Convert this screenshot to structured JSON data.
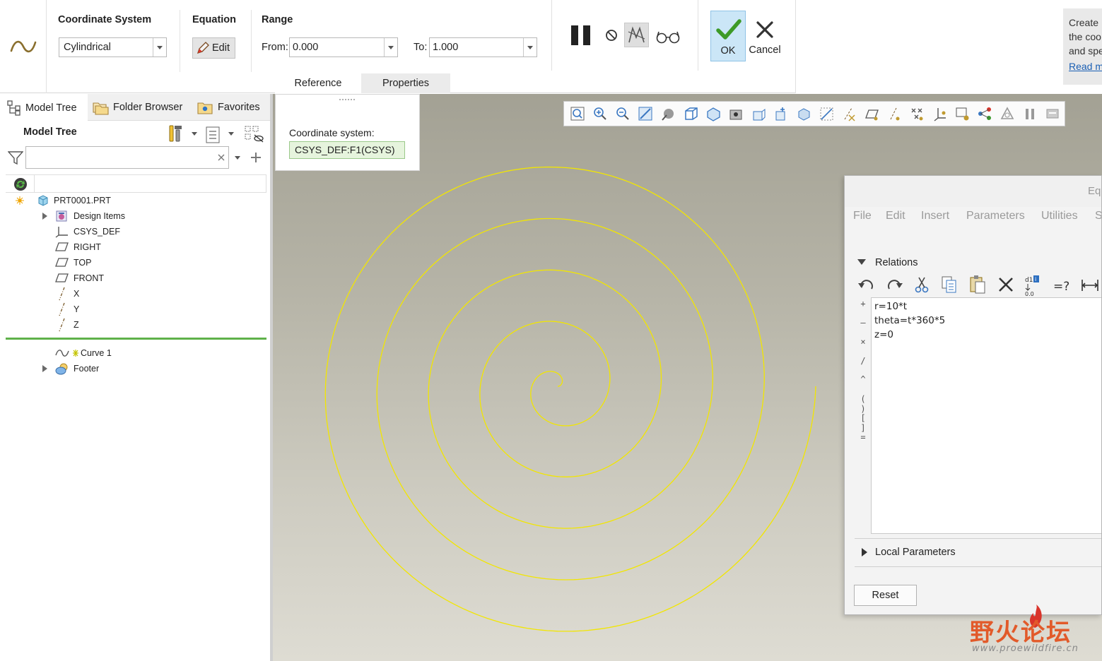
{
  "ribbon": {
    "coord_system": {
      "label": "Coordinate System",
      "value": "Cylindrical"
    },
    "equation": {
      "label": "Equation",
      "edit_label": "Edit"
    },
    "range": {
      "label": "Range",
      "from_label": "From:",
      "from_value": "0.000",
      "to_label": "To:",
      "to_value": "1.000"
    },
    "ok_label": "OK",
    "cancel_label": "Cancel",
    "tabs": [
      {
        "label": "Reference"
      },
      {
        "label": "Properties"
      }
    ],
    "tip_lines": [
      "Create",
      "the coo",
      "and spe"
    ],
    "tip_link": "Read m"
  },
  "left_panel": {
    "tabs": [
      {
        "label": "Model Tree"
      },
      {
        "label": "Folder Browser"
      },
      {
        "label": "Favorites"
      }
    ],
    "tree_title": "Model Tree",
    "search_placeholder": "",
    "tree": [
      {
        "label": "PRT0001.PRT"
      },
      {
        "label": "Design Items"
      },
      {
        "label": "CSYS_DEF"
      },
      {
        "label": "RIGHT"
      },
      {
        "label": "TOP"
      },
      {
        "label": "FRONT"
      },
      {
        "label": "X"
      },
      {
        "label": "Y"
      },
      {
        "label": "Z"
      },
      {
        "label": "Curve 1"
      },
      {
        "label": "Footer"
      }
    ]
  },
  "reference_panel": {
    "label": "Coordinate system:",
    "value": "CSYS_DEF:F1(CSYS)"
  },
  "curve": {
    "color": "#f2e600",
    "turns": 5
  },
  "equation_dialog": {
    "title": "Eq",
    "menu": [
      "File",
      "Edit",
      "Insert",
      "Parameters",
      "Utilities",
      "S"
    ],
    "relations_label": "Relations",
    "relations": [
      "r=10*t",
      "theta=t*360*5",
      "z=0"
    ],
    "operators": [
      "+",
      "–",
      "×",
      "/",
      "^",
      "( )",
      "[ ]",
      "="
    ],
    "local_params_label": "Local Parameters",
    "reset_label": "Reset"
  },
  "watermark": {
    "text": "野火论坛",
    "url": "www.proewildfire.cn"
  }
}
